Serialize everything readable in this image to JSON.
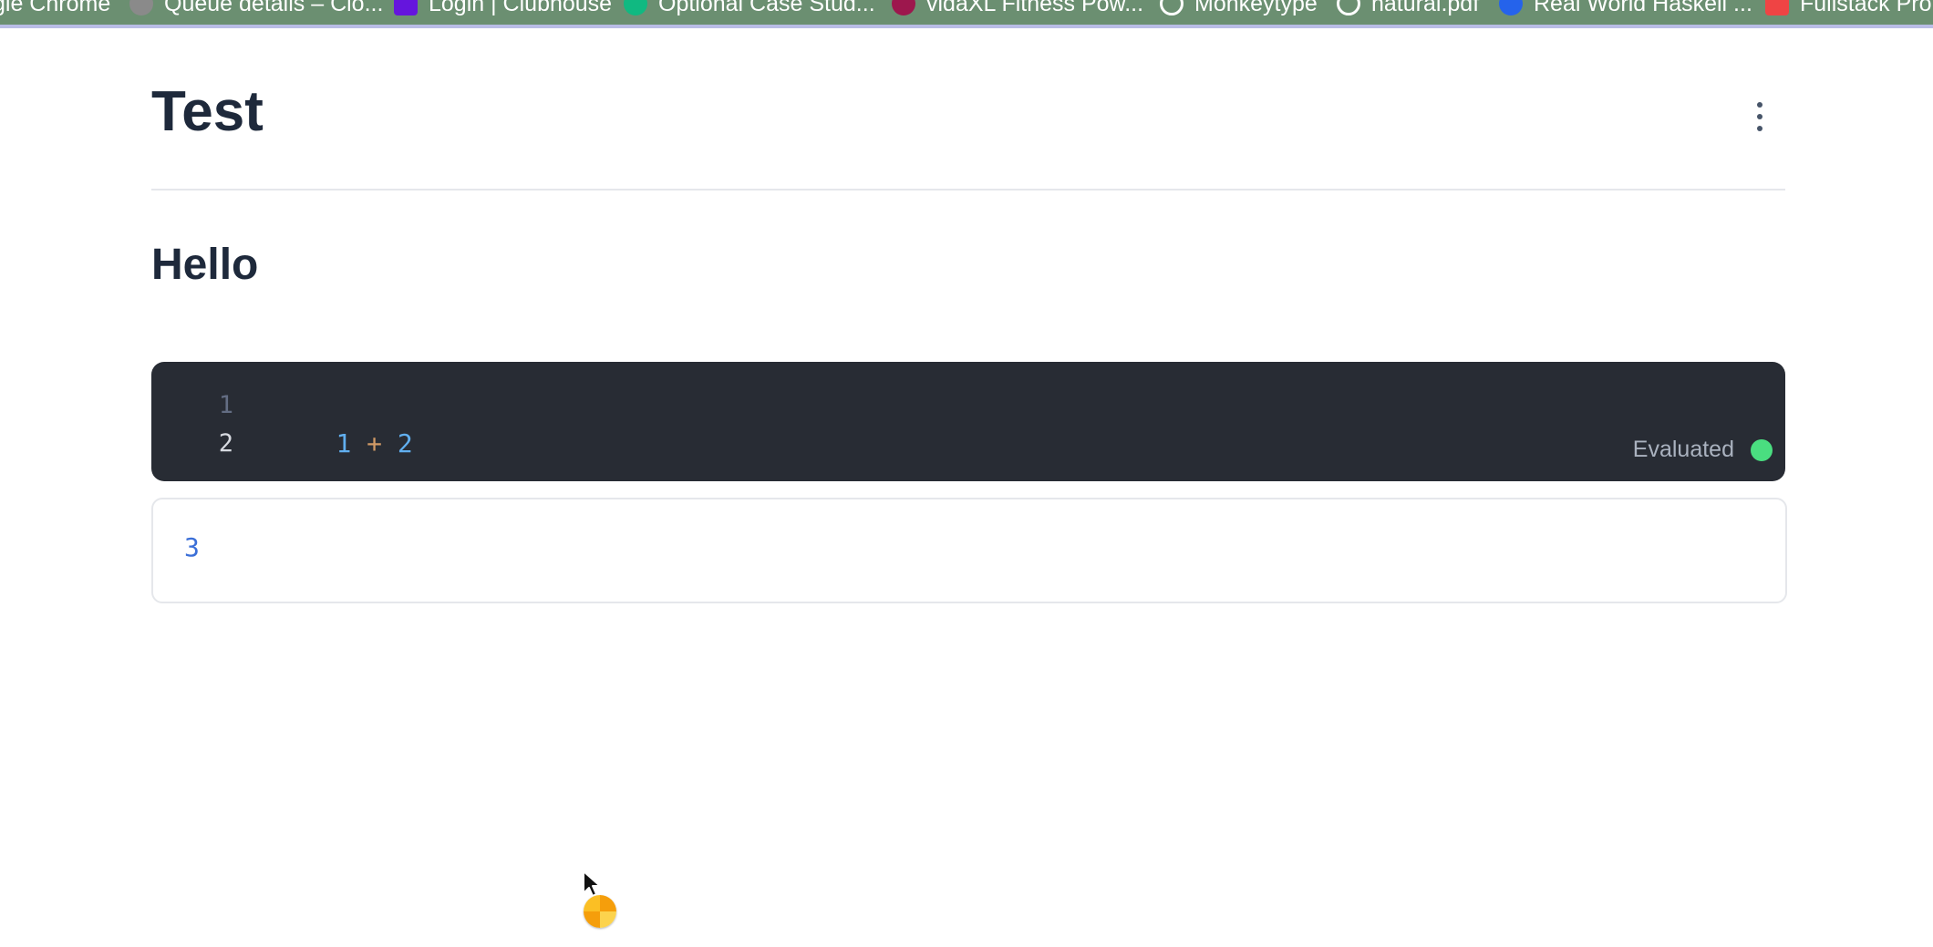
{
  "bookmarks": [
    {
      "label": "gle Chrome",
      "icon": "none"
    },
    {
      "label": "Queue details – Clo...",
      "icon": "grey-circle-icon"
    },
    {
      "label": "Login | Clubhouse",
      "icon": "clubhouse-icon"
    },
    {
      "label": "Optional Case Stud...",
      "icon": "case-study-icon"
    },
    {
      "label": "vidaXL Fitness Pow...",
      "icon": "vidaxl-icon"
    },
    {
      "label": "Monkeytype",
      "icon": "globe-icon"
    },
    {
      "label": "natural.pdf",
      "icon": "globe-icon"
    },
    {
      "label": "Real World Haskell ...",
      "icon": "haskell-icon"
    },
    {
      "label": "Fullstack Pro",
      "icon": "fullstack-icon"
    }
  ],
  "notebook": {
    "title": "Test",
    "heading": "Hello",
    "code_cell": {
      "line_numbers": [
        "1",
        "2"
      ],
      "tokens": [
        {
          "text": "1",
          "kind": "num"
        },
        {
          "text": " + ",
          "kind": "op"
        },
        {
          "text": "2",
          "kind": "num"
        }
      ],
      "status": "Evaluated",
      "status_color": "#4ade80"
    },
    "output": "3"
  },
  "colors": {
    "bookmarks_bg": "#6b8f71",
    "code_bg": "#282c34",
    "title_text": "#1e293b",
    "output_text": "#3b6fd8"
  }
}
